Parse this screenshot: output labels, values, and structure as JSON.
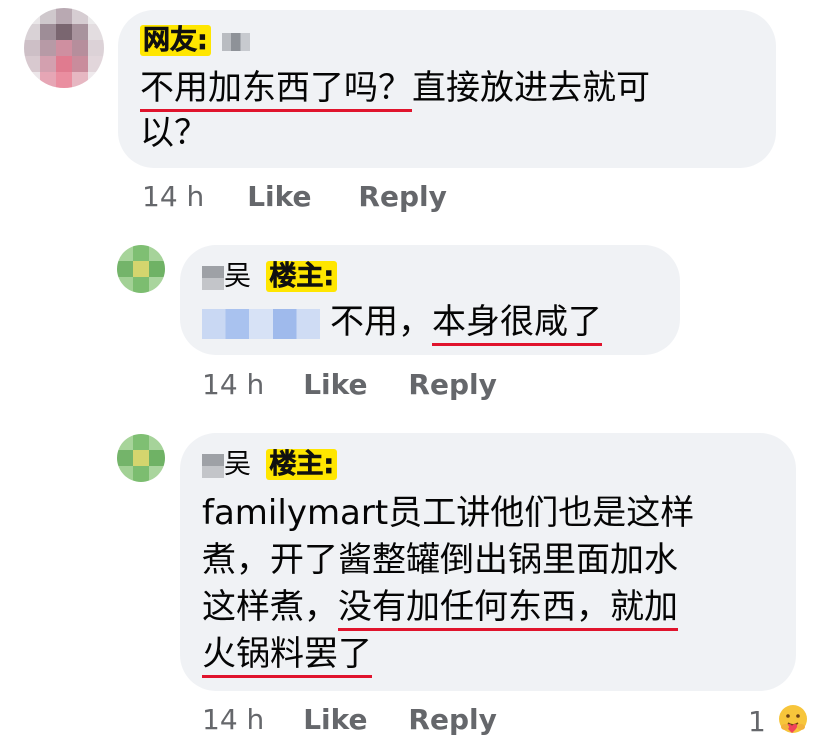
{
  "comments": [
    {
      "author_visible": "",
      "tag": "网友:",
      "line1_ul": "不用加东西了吗？",
      "line1_rest": "直接放进去就可",
      "line2": "以？",
      "time": "14 h",
      "like": "Like",
      "reply": "Reply"
    },
    {
      "author_visible": "吴",
      "tag": "楼主:",
      "text_plain": "不用，",
      "text_ul": "本身很咸了",
      "time": "14 h",
      "like": "Like",
      "reply": "Reply"
    },
    {
      "author_visible": "吴",
      "tag": "楼主:",
      "line1": "familymart员工讲他们也是这样",
      "line2": "煮，开了酱整罐倒出锅里面加水",
      "line3_plain": "这样煮，",
      "line3_ul": "没有加任何东西",
      "line3_rest": "，就加",
      "line4_ul": "火锅料罢了",
      "time": "14 h",
      "like": "Like",
      "reply": "Reply",
      "reaction_count": "1",
      "reaction_icon": "care-emoji-icon"
    }
  ]
}
